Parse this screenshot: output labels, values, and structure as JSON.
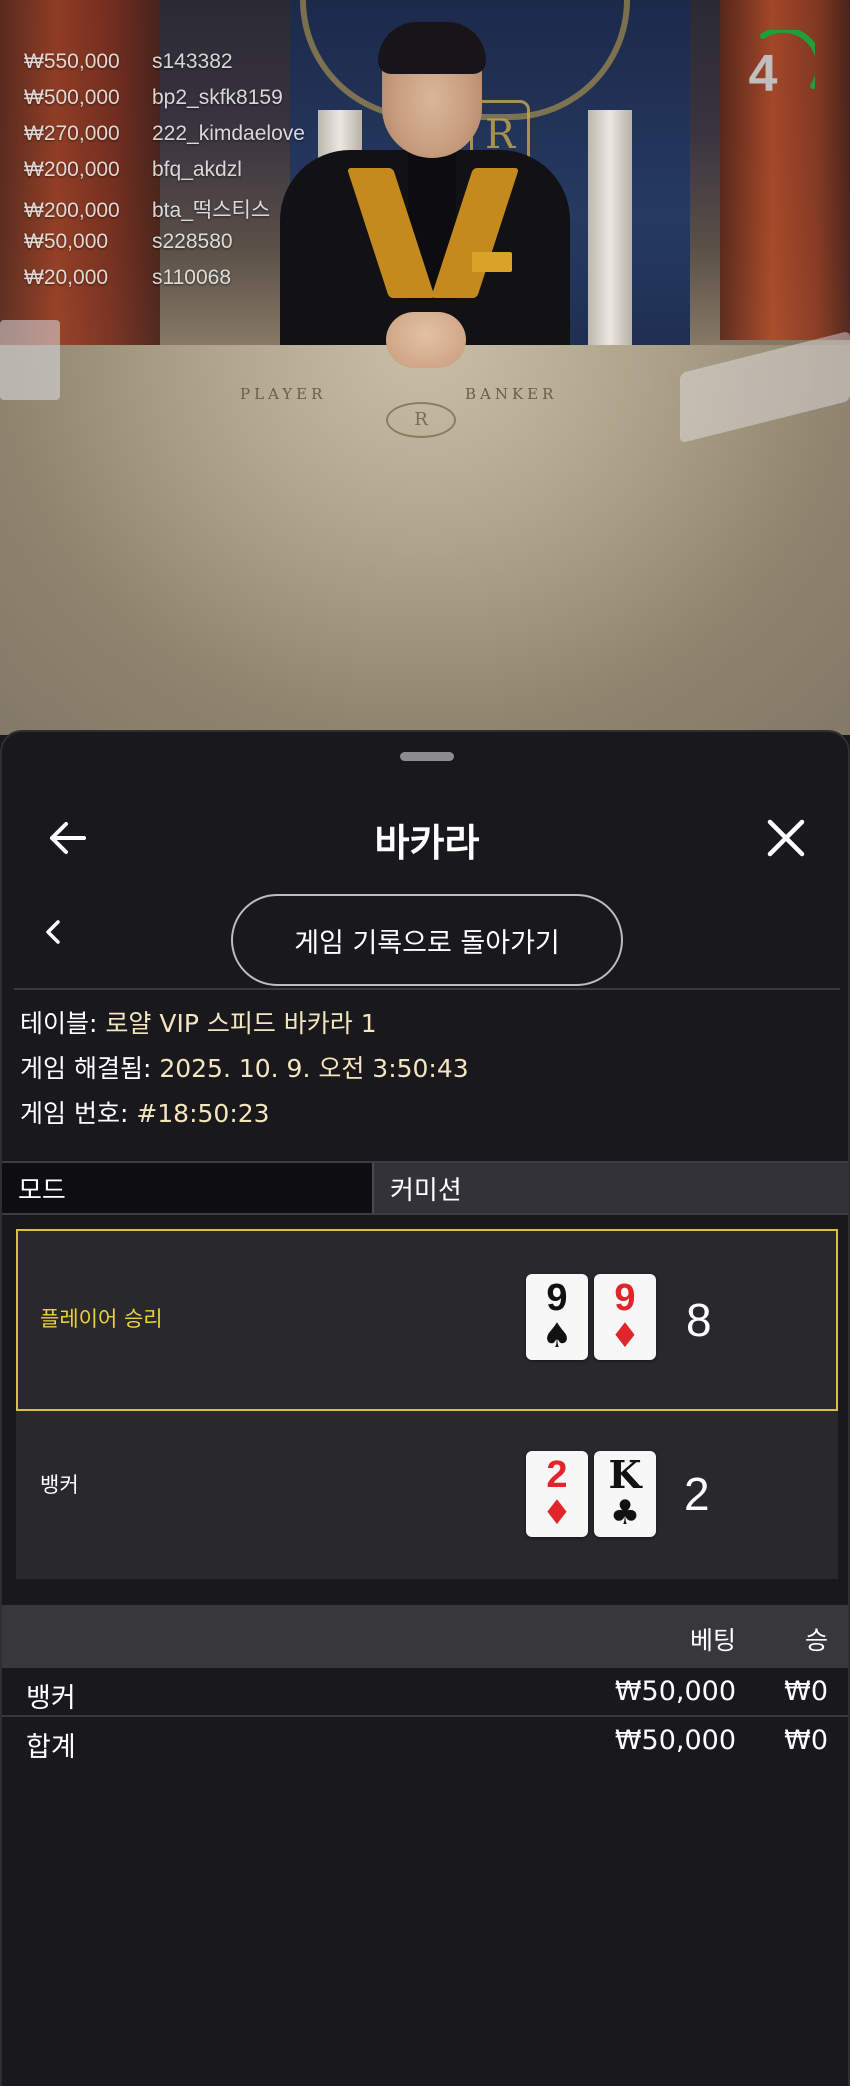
{
  "stream": {
    "countdown": "4",
    "bets": [
      {
        "amount": "₩550,000",
        "user": "s143382"
      },
      {
        "amount": "₩500,000",
        "user": "bp2_skfk8159"
      },
      {
        "amount": "₩270,000",
        "user": "222_kimdaelove"
      },
      {
        "amount": "₩200,000",
        "user": "bfq_akdzl"
      },
      {
        "amount": "₩200,000",
        "user": "bta_떡스티스"
      },
      {
        "amount": "₩50,000",
        "user": "s228580"
      },
      {
        "amount": "₩20,000",
        "user": "s110068"
      }
    ],
    "table_labels": {
      "player": "PLAYER",
      "banker": "BANKER",
      "crest": "R"
    }
  },
  "sheet": {
    "title": "바카라",
    "back_to_history": "게임 기록으로 돌아가기",
    "info": {
      "table_label": "테이블:",
      "table_value": "로얄 VIP 스피드 바카라 1",
      "resolved_label": "게임 해결됨:",
      "resolved_value": "2025. 10. 9. 오전 3:50:43",
      "number_label": "게임 번호:",
      "number_value": "#18:50:23"
    },
    "tabs": {
      "mode": "모드",
      "commission": "커미션"
    },
    "hands": {
      "player": {
        "label": "플레이어 승리",
        "total": "8",
        "cards": [
          {
            "rank": "9",
            "suit": "♠",
            "color": "black"
          },
          {
            "rank": "9",
            "suit": "♦",
            "color": "red"
          }
        ]
      },
      "banker": {
        "label": "뱅커",
        "total": "2",
        "cards": [
          {
            "rank": "2",
            "suit": "♦",
            "color": "red"
          },
          {
            "rank": "K",
            "suit": "♣",
            "color": "black"
          }
        ]
      }
    },
    "bets_table": {
      "headers": {
        "bet": "베팅",
        "win": "승"
      },
      "rows": [
        {
          "name": "뱅커",
          "bet": "₩50,000",
          "win": "₩0"
        },
        {
          "name": "합계",
          "bet": "₩50,000",
          "win": "₩0"
        }
      ]
    }
  },
  "colors": {
    "winner_border": "#d8c23a",
    "winner_text": "#ecd13a",
    "red_suit": "#e0262a",
    "timer_green": "#1f9e3a"
  },
  "icons": {
    "back": "arrow-left-icon",
    "close": "close-icon",
    "chevron": "chevron-left-icon"
  }
}
